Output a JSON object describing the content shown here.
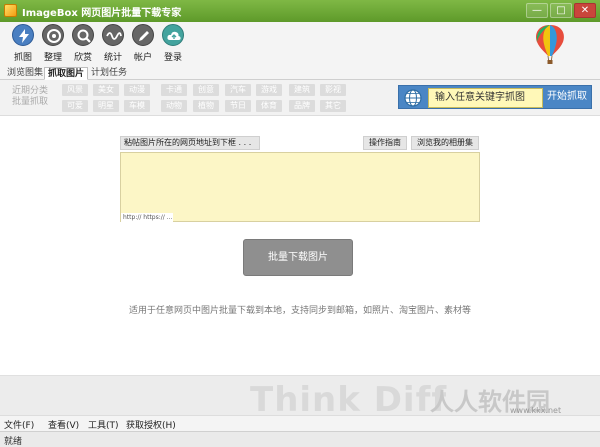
{
  "window": {
    "title": "ImageBox 网页图片批量下载专家",
    "minimize": "—",
    "maximize": "□",
    "close": "✕"
  },
  "toolbar": {
    "items": [
      {
        "label": "抓图",
        "icon": "lightning-icon"
      },
      {
        "label": "整理",
        "icon": "disc-icon"
      },
      {
        "label": "欣赏",
        "icon": "magnifier-icon"
      },
      {
        "label": "统计",
        "icon": "wave-icon"
      },
      {
        "label": "帐户",
        "icon": "pen-icon"
      },
      {
        "label": "登录",
        "icon": "cloud-icon"
      }
    ]
  },
  "tabs": [
    {
      "label": "浏览图集",
      "active": false
    },
    {
      "label": "抓取图片",
      "active": true
    },
    {
      "label": "计划任务",
      "active": false
    }
  ],
  "categories": {
    "hint": "近期分类批量抓取",
    "row1": [
      "风景",
      "美女",
      "动漫",
      "卡通",
      "创意",
      "汽车",
      "游戏",
      "建筑",
      "影视"
    ],
    "row2": [
      "可爱",
      "明星",
      "车模",
      "动物",
      "植物",
      "节日",
      "体育",
      "品牌",
      "其它"
    ]
  },
  "keyword_search": {
    "placeholder": "输入任意关键字抓图",
    "button": "开始抓取"
  },
  "main": {
    "paste_label": "粘帖图片所在的网页地址到下框 . . .",
    "guide_button": "操作指南",
    "album_button": "浏览我的相册集",
    "url_hint": "http:// https:// ...",
    "download_button": "批量下载图片",
    "description": "适用于任意网页中图片批量下载到本地，支持同步到邮箱，如照片、淘宝图片、素材等"
  },
  "watermark": {
    "text": "Think Diff",
    "brand": "人人软件园",
    "site": "www.kkx.net"
  },
  "menubar": [
    "文件(F)",
    "查看(V)",
    "工具(T)",
    "获取授权(H)"
  ],
  "status": "就绪",
  "colors": {
    "titlebar": "#6aa534",
    "keybox": "#4a86c5",
    "keyinput": "#fff8b8",
    "urlarea": "#fcf6c6",
    "download": "#8f8f8f"
  }
}
